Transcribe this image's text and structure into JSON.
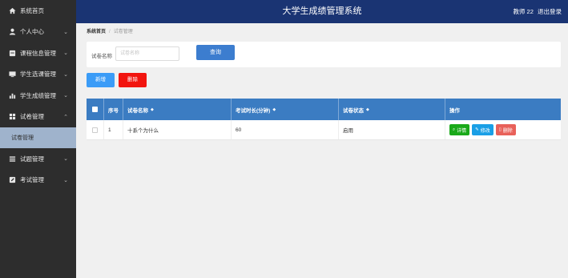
{
  "app": {
    "title": "大学生成绩管理系统",
    "user_label": "教师 22",
    "logout": "退出登录"
  },
  "sidebar": {
    "items": [
      {
        "label": "系统首页",
        "icon": "home-icon"
      },
      {
        "label": "个人中心",
        "icon": "user-icon",
        "chevron": "v"
      },
      {
        "label": "课程信息管理",
        "icon": "book-icon",
        "chevron": "v"
      },
      {
        "label": "学生选课管理",
        "icon": "monitor-icon",
        "chevron": "v"
      },
      {
        "label": "学生成绩管理",
        "icon": "bar-chart-icon",
        "chevron": "v"
      },
      {
        "label": "试卷管理",
        "icon": "grid-icon",
        "chevron": "^"
      },
      {
        "label": "试题管理",
        "icon": "list-icon",
        "chevron": "v"
      },
      {
        "label": "考试管理",
        "icon": "edit-icon",
        "chevron": "v"
      }
    ],
    "sub_item": "试卷管理"
  },
  "breadcrumb": {
    "home": "系统首页",
    "current": "试卷管理"
  },
  "search": {
    "label": "试卷名称",
    "placeholder": "试卷名称",
    "query_button": "查询"
  },
  "toolbar": {
    "add": "新增",
    "delete": "删除"
  },
  "table": {
    "headers": {
      "index": "序号",
      "name": "试卷名称",
      "duration": "考试时长(分钟)",
      "status": "试卷状态",
      "actions": "操作"
    },
    "rows": [
      {
        "index": "1",
        "name": "十系个为什么",
        "duration": "60",
        "status": "启用"
      }
    ],
    "actions": {
      "detail": "详情",
      "edit": "修改",
      "remove": "删除"
    }
  },
  "colors": {
    "header_bg": "#1a3473",
    "sidebar_bg": "#2d2d2d",
    "table_header_bg": "#3b7cc2",
    "query_btn": "#3c7dcf",
    "add_btn": "#3b9cf7",
    "delete_btn": "#f2150f",
    "detail_btn": "#1aa91a",
    "edit_btn": "#1a9fe6",
    "remove_btn": "#e8615a"
  }
}
